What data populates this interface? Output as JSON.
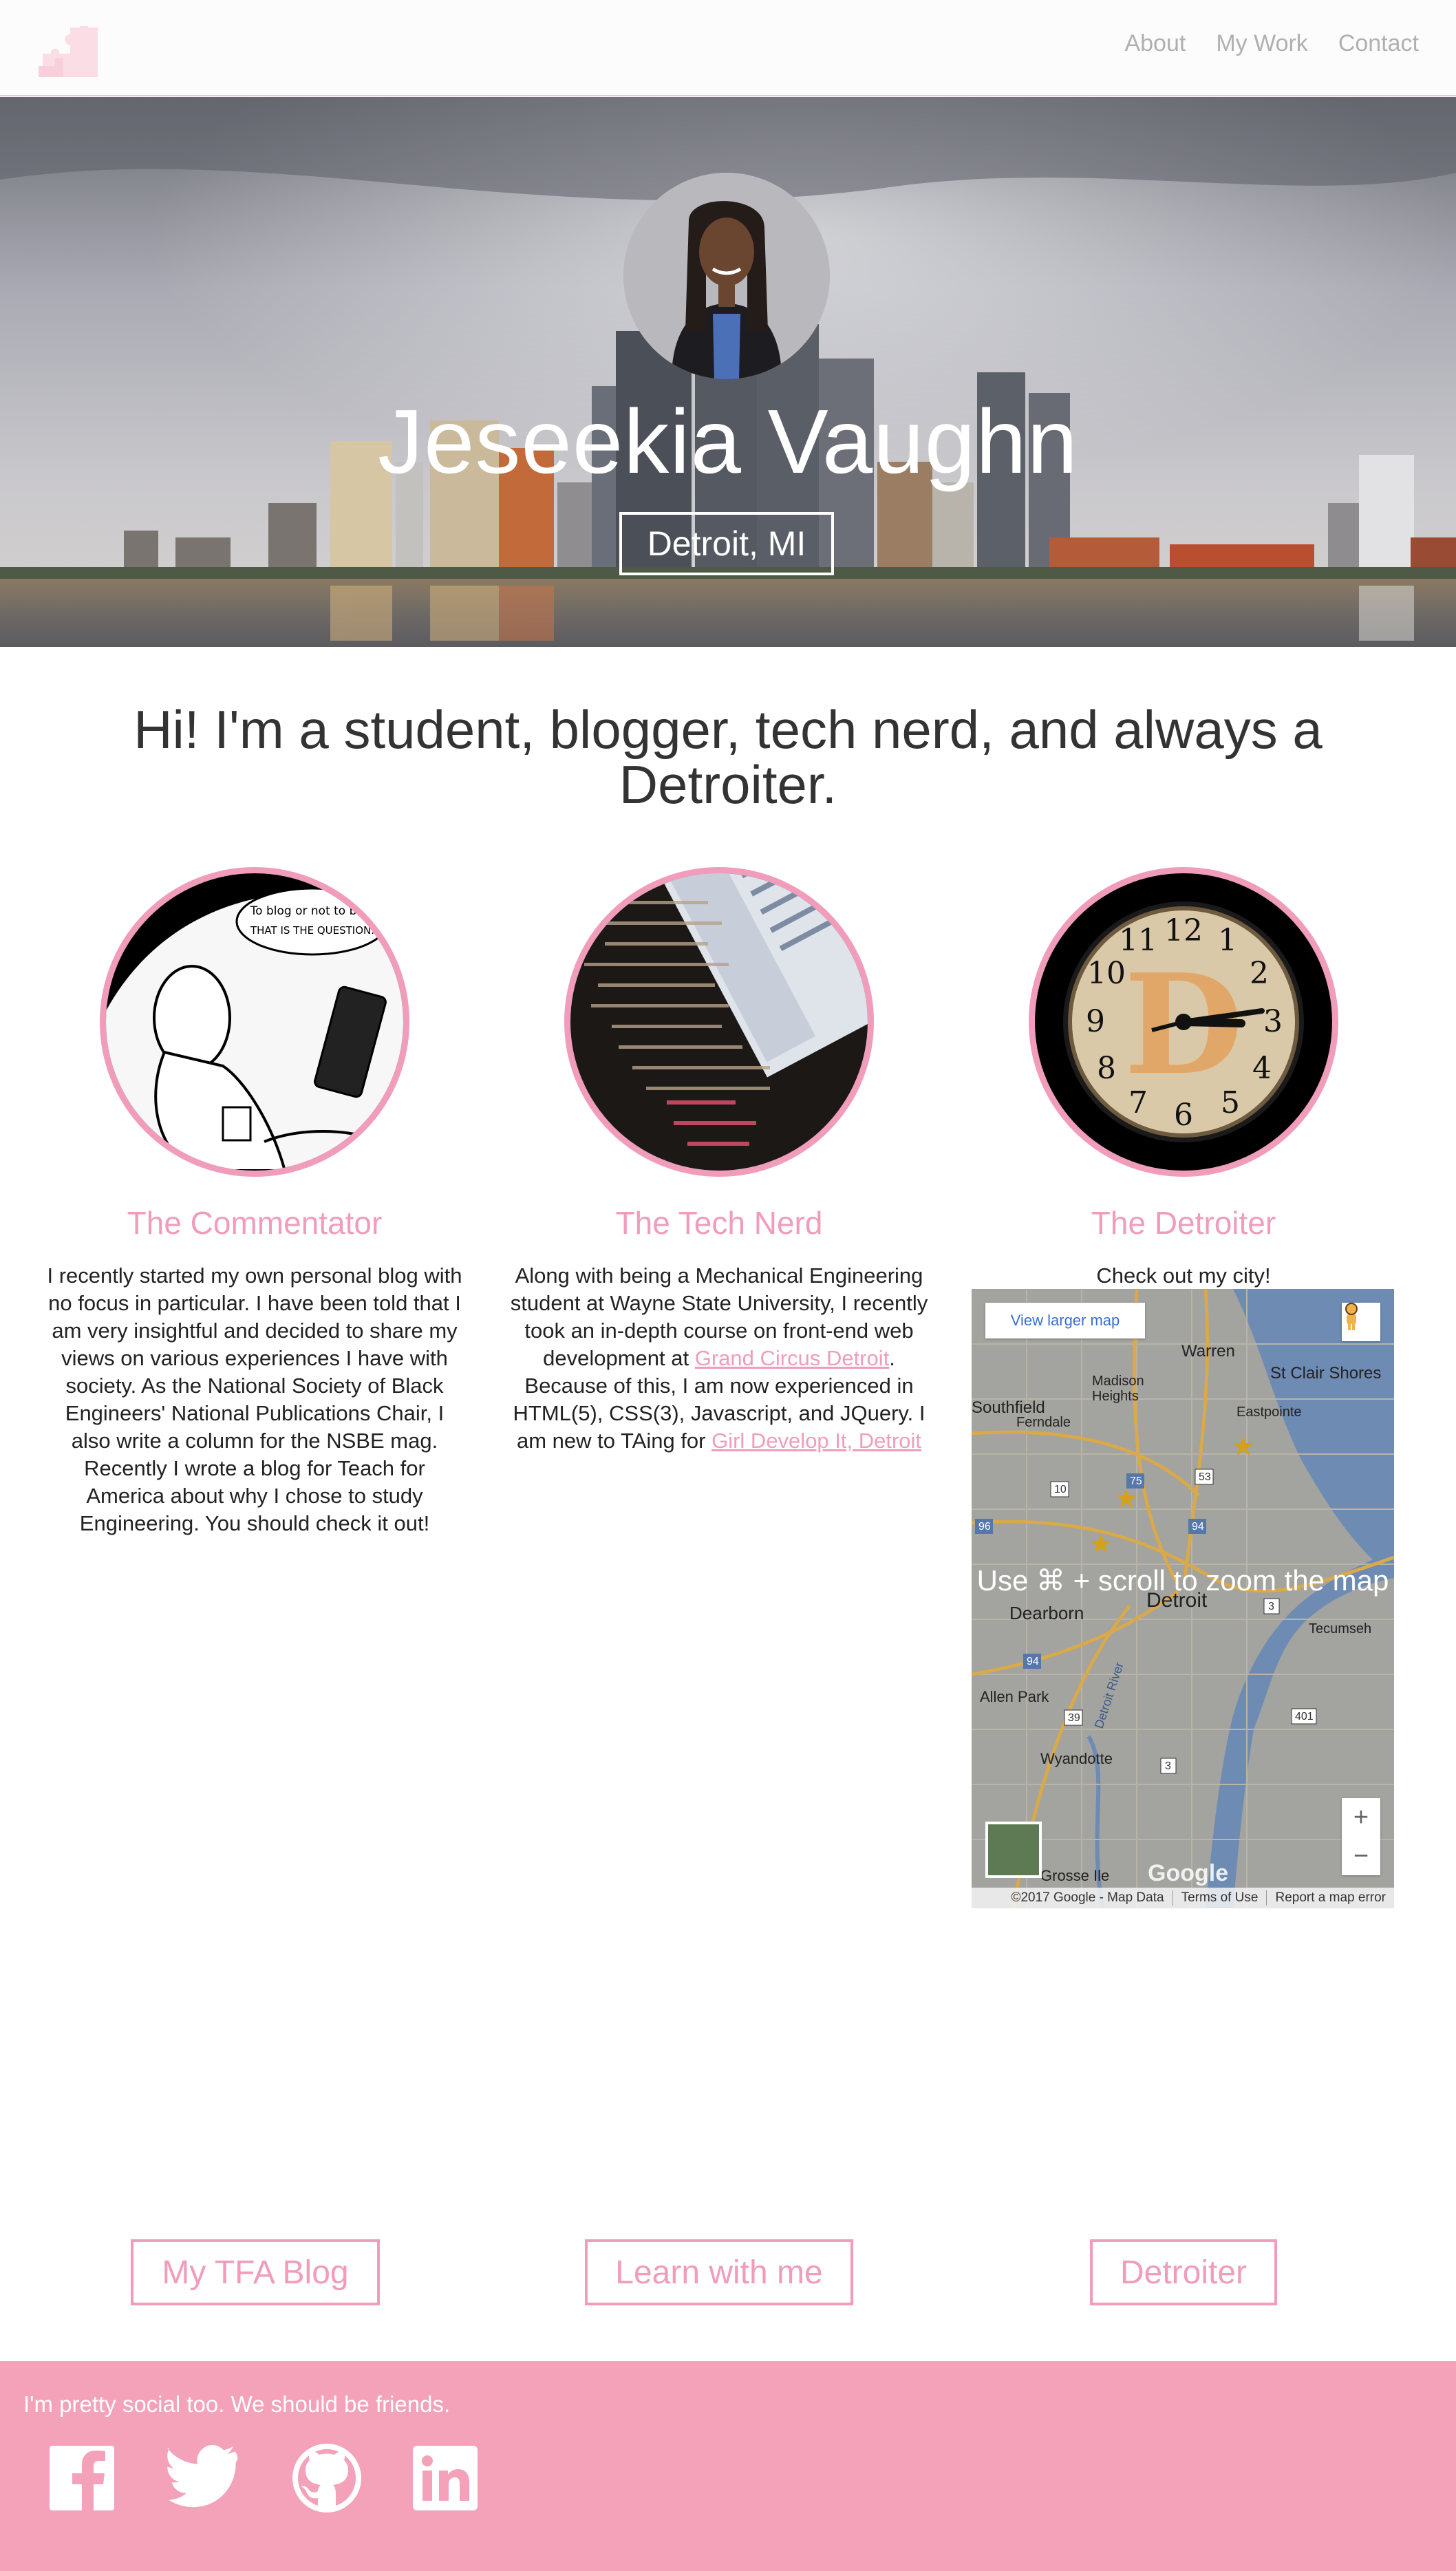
{
  "nav": {
    "logo_icon": "puzzle-pieces-logo",
    "links": [
      "About",
      "My Work",
      "Contact"
    ]
  },
  "hero": {
    "name": "Jeseekia Vaughn",
    "location": "Detroit, MI"
  },
  "intro": "Hi! I'm a student, blogger, tech nerd, and always a Detroiter.",
  "columns": [
    {
      "title": "The Commentator",
      "image_caption_1": "To blog or not to blog",
      "image_caption_2": "THAT IS THE QUESTION.",
      "text": "I recently started my own personal blog with no focus in particular. I have been told that I am very insightful and decided to share my views on various experiences I have with society. As the National Society of Black Engineers' National Publications Chair, I also write a column for the NSBE mag. Recently I wrote a blog for Teach for America about why I chose to study Engineering. You should check it out!"
    },
    {
      "title": "The Tech Nerd",
      "text_1": "Along with being a Mechanical Engineering student at Wayne State University, I recently took an in-depth course on front-end web development at ",
      "link_1": "Grand Circus Detroit",
      "text_2": ". Because of this, I am now experienced in HTML(5), CSS(3), Javascript, and JQuery. I am new to TAing for ",
      "link_2": "Girl Develop It, Detroit"
    },
    {
      "title": "The Detroiter",
      "text": "Check out my city!"
    }
  ],
  "map": {
    "view_larger": "View larger map",
    "overlay": "Use ⌘ + scroll to zoom the map",
    "zoom_in": "+",
    "zoom_out": "−",
    "logo": "Google",
    "footer": [
      "©2017 Google - Map Data",
      "Terms of Use",
      "Report a map error"
    ],
    "labels": {
      "warren": "Warren",
      "st_clair": "St Clair Shores",
      "madison": "Madison",
      "heights": "Heights",
      "eastpointe": "Eastpointe",
      "southfield": "Southfield",
      "ferndale": "Ferndale",
      "detroit": "Detroit",
      "dearborn": "Dearborn",
      "tecumseh": "Tecumseh",
      "allen_park": "Allen Park",
      "wyandotte": "Wyandotte",
      "grosse_ile": "Grosse Ile",
      "detroit_river": "Detroit River",
      "h75": "75",
      "h53": "53",
      "h10": "10",
      "h96": "96",
      "h94a": "94",
      "h94b": "94",
      "h401": "401",
      "h3": "3",
      "h39": "39",
      "h3b": "3"
    }
  },
  "buttons": [
    "My TFA Blog",
    "Learn with me",
    "Detroiter"
  ],
  "footer": {
    "text": "I'm pretty social too. We should be friends.",
    "social_icons": [
      "facebook-icon",
      "twitter-icon",
      "github-icon",
      "linkedin-icon"
    ]
  },
  "colors": {
    "accent_pink": "#f09cba",
    "footer_pink": "#f3a2ba",
    "nav_link": "#b0b0b0"
  }
}
